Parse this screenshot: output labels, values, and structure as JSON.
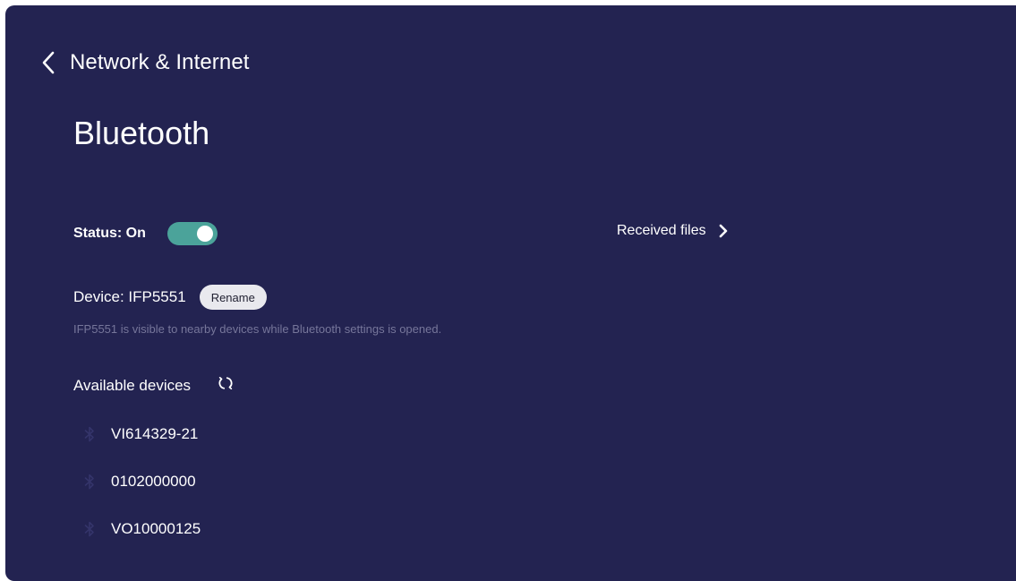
{
  "header": {
    "back_label": "Network & Internet",
    "back_icon": "chevron-left-icon"
  },
  "page": {
    "title": "Bluetooth"
  },
  "status": {
    "label": "Status: On",
    "toggle_on": true,
    "toggle_color": "#4ba39a"
  },
  "received_files": {
    "label": "Received files",
    "icon": "chevron-right-icon"
  },
  "device": {
    "label": "Device: IFP5551",
    "rename_label": "Rename",
    "visibility_note": "IFP5551 is visible to nearby devices while Bluetooth settings is opened."
  },
  "available": {
    "label": "Available devices",
    "refresh_icon": "refresh-icon",
    "devices": [
      {
        "name": "VI614329-21",
        "icon": "bluetooth-icon"
      },
      {
        "name": "0102000000",
        "icon": "bluetooth-icon"
      },
      {
        "name": "VO10000125",
        "icon": "bluetooth-icon"
      }
    ]
  },
  "colors": {
    "background": "#232351",
    "accent": "#4ba39a",
    "muted_text": "#76769a",
    "button_bg": "#e9e9ee"
  }
}
